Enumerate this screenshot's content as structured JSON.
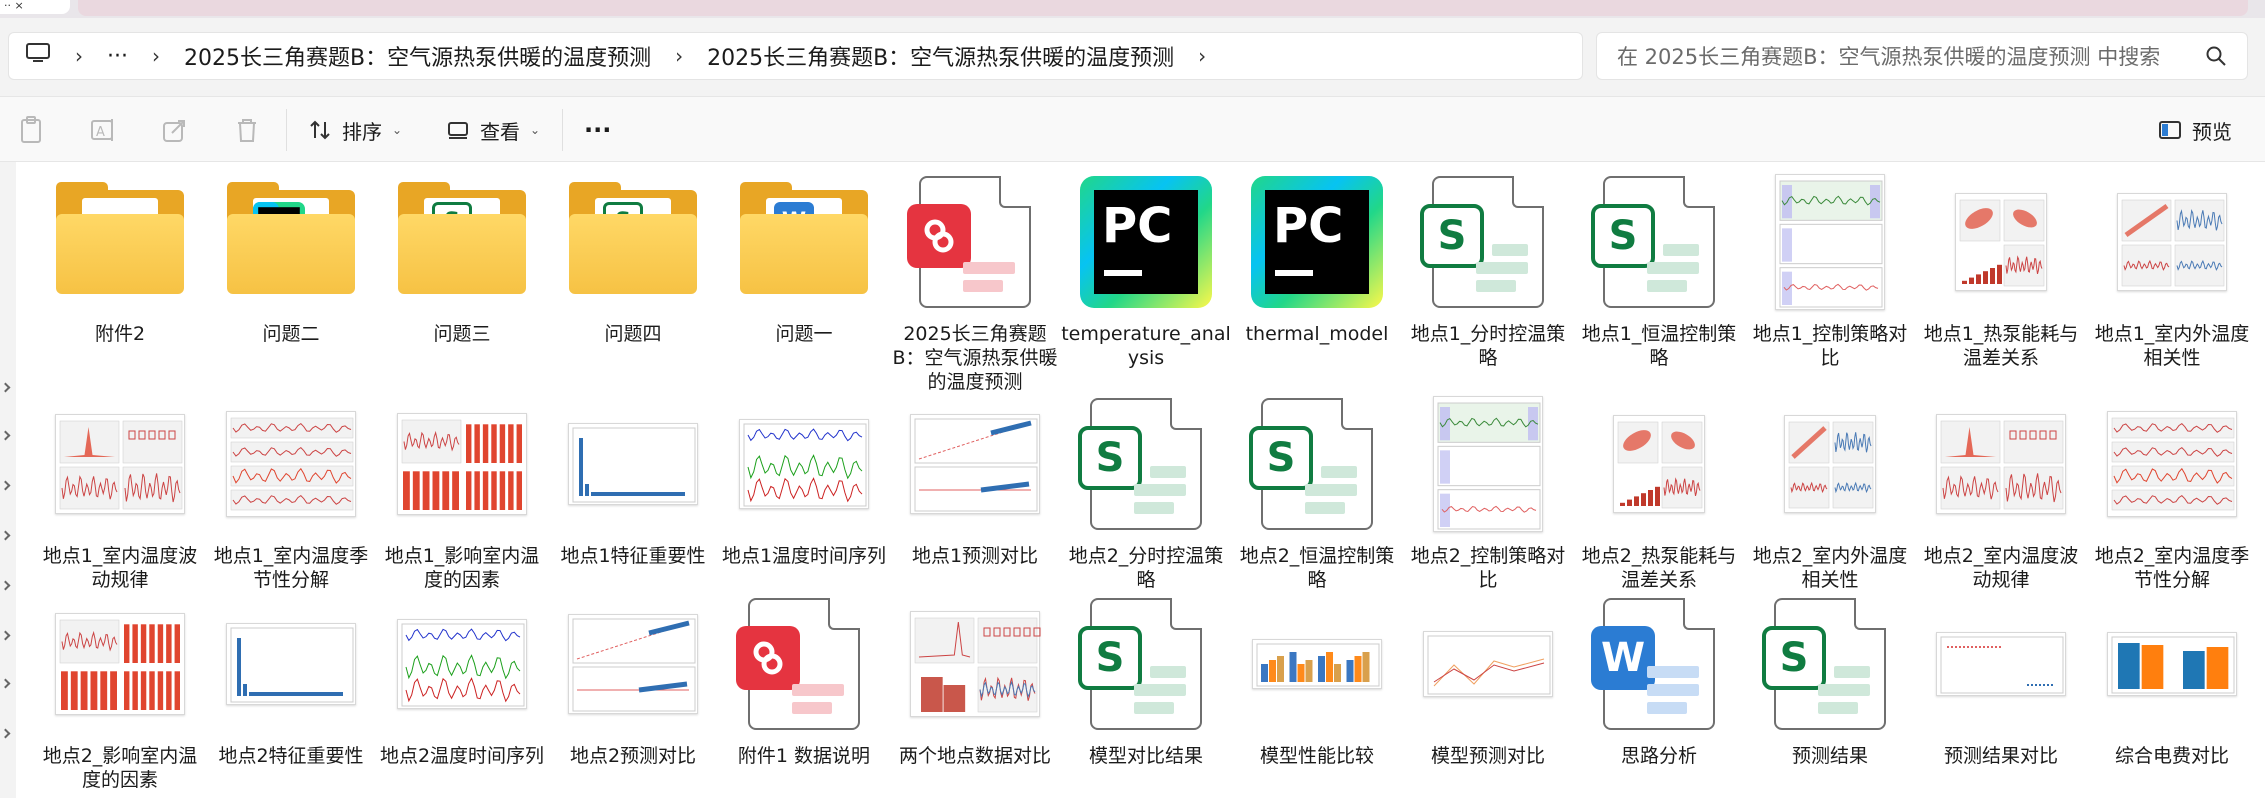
{
  "titlebar": {
    "tab_fragment": "·· ×"
  },
  "breadcrumb": {
    "overflow": "···",
    "items": [
      "2025长三角赛题B：空气源热泵供暖的温度预测",
      "2025长三角赛题B：空气源热泵供暖的温度预测"
    ]
  },
  "search": {
    "placeholder": "在 2025长三角赛题B：空气源热泵供暖的温度预测 中搜索"
  },
  "toolbar": {
    "sort_label": "排序",
    "view_label": "查看",
    "more_label": "···",
    "preview_label": "预览"
  },
  "files": [
    {
      "name": "附件2",
      "kind": "folder"
    },
    {
      "name": "问题二",
      "kind": "folder-pycharm"
    },
    {
      "name": "问题三",
      "kind": "folder-sheet"
    },
    {
      "name": "问题四",
      "kind": "folder-sheet"
    },
    {
      "name": "问题一",
      "kind": "folder-word"
    },
    {
      "name": "2025长三角赛题B：空气源热泵供暖的温度预测",
      "kind": "pdf"
    },
    {
      "name": "temperature_analysis",
      "kind": "pycharm"
    },
    {
      "name": "thermal_model",
      "kind": "pycharm"
    },
    {
      "name": "地点1_分时控温策略",
      "kind": "sheet"
    },
    {
      "name": "地点1_恒温控制策略",
      "kind": "sheet"
    },
    {
      "name": "地点1_控制策略对比",
      "kind": "chart-strategy"
    },
    {
      "name": "地点1_热泵能耗与温差关系",
      "kind": "chart-energy"
    },
    {
      "name": "地点1_室内外温度相关性",
      "kind": "chart-corr"
    },
    {
      "name": "地点1_室内温度波动规律",
      "kind": "chart-wave"
    },
    {
      "name": "地点1_室内温度季节性分解",
      "kind": "chart-season"
    },
    {
      "name": "地点1_影响室内温度的因素",
      "kind": "chart-factor"
    },
    {
      "name": "地点1特征重要性",
      "kind": "chart-importance"
    },
    {
      "name": "地点1温度时间序列",
      "kind": "chart-series"
    },
    {
      "name": "地点1预测对比",
      "kind": "chart-predict"
    },
    {
      "name": "地点2_分时控温策略",
      "kind": "sheet"
    },
    {
      "name": "地点2_恒温控制策略",
      "kind": "sheet"
    },
    {
      "name": "地点2_控制策略对比",
      "kind": "chart-strategy"
    },
    {
      "name": "地点2_热泵能耗与温差关系",
      "kind": "chart-energy"
    },
    {
      "name": "地点2_室内外温度相关性",
      "kind": "chart-corr2"
    },
    {
      "name": "地点2_室内温度波动规律",
      "kind": "chart-wave"
    },
    {
      "name": "地点2_室内温度季节性分解",
      "kind": "chart-season"
    },
    {
      "name": "地点2_影响室内温度的因素",
      "kind": "chart-factor"
    },
    {
      "name": "地点2特征重要性",
      "kind": "chart-importance"
    },
    {
      "name": "地点2温度时间序列",
      "kind": "chart-series"
    },
    {
      "name": "地点2预测对比",
      "kind": "chart-predict"
    },
    {
      "name": "附件1 数据说明",
      "kind": "pdf"
    },
    {
      "name": "两个地点数据对比",
      "kind": "chart-twosite"
    },
    {
      "name": "模型对比结果",
      "kind": "sheet"
    },
    {
      "name": "模型性能比较",
      "kind": "chart-perf"
    },
    {
      "name": "模型预测对比",
      "kind": "chart-modelpred"
    },
    {
      "name": "思路分析",
      "kind": "word"
    },
    {
      "name": "预测结果",
      "kind": "sheet"
    },
    {
      "name": "预测结果对比",
      "kind": "chart-resultcmp"
    },
    {
      "name": "综合电费对比",
      "kind": "chart-cost"
    }
  ],
  "colors": {
    "folder": "#f6c244",
    "sheet": "#107c41",
    "pdf": "#e53440",
    "word": "#2b7cd3",
    "accent_red": "#e0452f"
  }
}
